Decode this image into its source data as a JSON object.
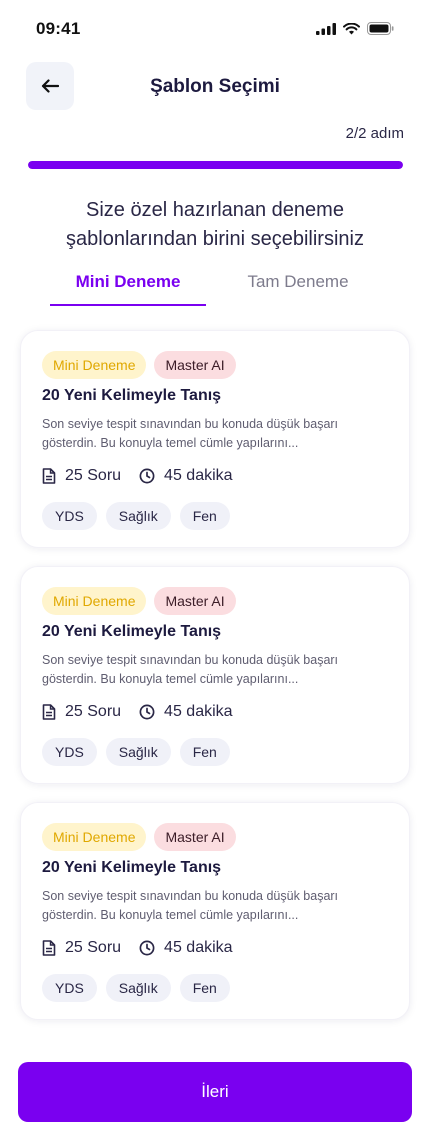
{
  "status_bar": {
    "time": "09:41",
    "icons": [
      "signal-icon",
      "wifi-icon",
      "battery-icon"
    ]
  },
  "header": {
    "back_icon": "arrow-left-icon",
    "title": "Şablon Seçimi"
  },
  "progress": {
    "step_text": "2/2 adım",
    "fraction": 1.0
  },
  "subtitle": "Size özel hazırlanan deneme şablonlarından birini seçebilirsiniz",
  "tabs": [
    {
      "label": "Mini Deneme",
      "active": true
    },
    {
      "label": "Tam Deneme",
      "active": false
    }
  ],
  "cards": [
    {
      "badges": [
        "Mini Deneme",
        "Master AI"
      ],
      "title": "20 Yeni Kelimeyle Tanış",
      "description": "Son seviye tespit sınavından bu konuda düşük başarı gösterdin. Bu konuyla temel cümle yapılarını...",
      "questions": "25 Soru",
      "duration": "45 dakika",
      "tags": [
        "YDS",
        "Sağlık",
        "Fen"
      ]
    },
    {
      "badges": [
        "Mini Deneme",
        "Master AI"
      ],
      "title": "20 Yeni Kelimeyle Tanış",
      "description": "Son seviye tespit sınavından bu konuda düşük başarı gösterdin. Bu konuyla temel cümle yapılarını...",
      "questions": "25 Soru",
      "duration": "45 dakika",
      "tags": [
        "YDS",
        "Sağlık",
        "Fen"
      ]
    },
    {
      "badges": [
        "Mini Deneme",
        "Master AI"
      ],
      "title": "20 Yeni Kelimeyle Tanış",
      "description": "Son seviye tespit sınavından bu konuda düşük başarı gösterdin. Bu konuyla temel cümle yapılarını...",
      "questions": "25 Soru",
      "duration": "45 dakika",
      "tags": [
        "YDS",
        "Sağlık",
        "Fen"
      ]
    }
  ],
  "footer": {
    "next_label": "İleri"
  },
  "colors": {
    "accent": "#7a00f0",
    "badge_mini_bg": "#fff4cc",
    "badge_ai_bg": "#fbdde0",
    "tag_bg": "#f0f1f8"
  }
}
